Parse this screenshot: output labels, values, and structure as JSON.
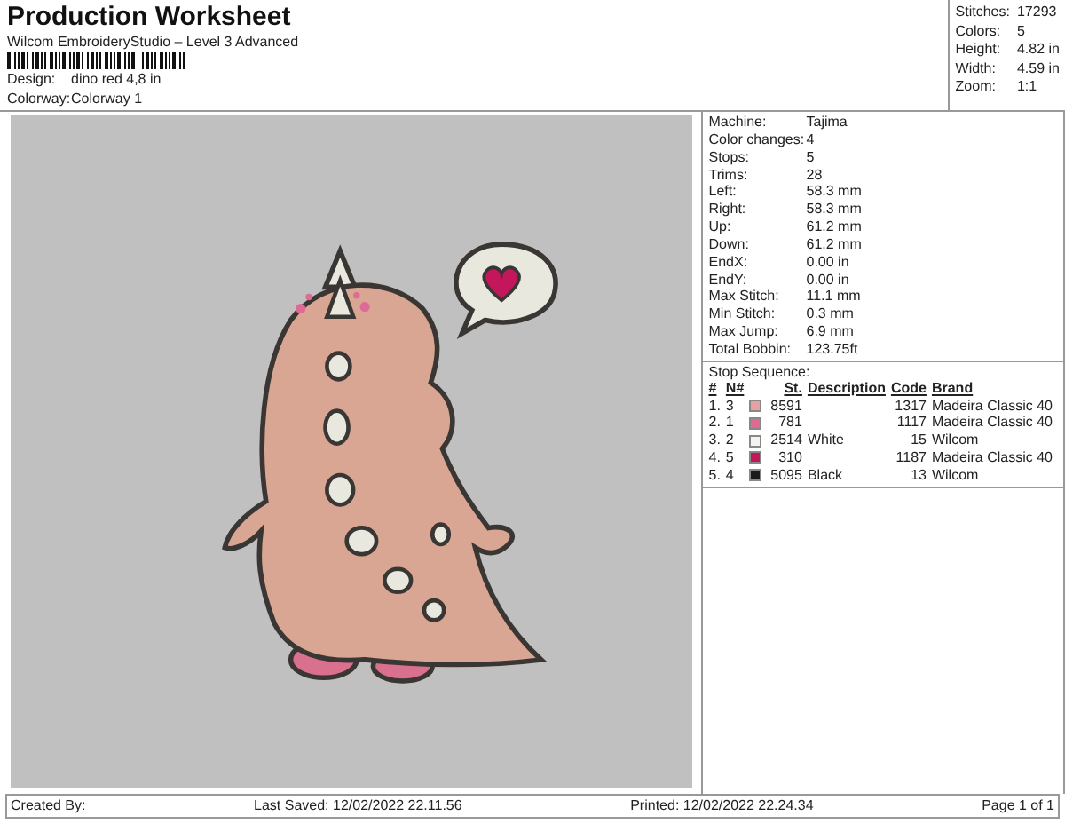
{
  "header": {
    "title": "Production Worksheet",
    "subtitle": "Wilcom EmbroideryStudio – Level 3 Advanced",
    "design": {
      "label": "Design:",
      "value": "dino red 4,8 in"
    },
    "colorway": {
      "label": "Colorway:",
      "value": "Colorway 1"
    }
  },
  "summary": [
    {
      "label": "Stitches:",
      "value": "17293"
    },
    {
      "label": "Colors:",
      "value": "5"
    },
    {
      "label": "Height:",
      "value": "4.82 in"
    },
    {
      "label": "Width:",
      "value": "4.59 in"
    },
    {
      "label": "Zoom:",
      "value": "1:1"
    }
  ],
  "properties": [
    {
      "label": "Machine:",
      "value": "Tajima"
    },
    {
      "label": "Color changes:",
      "value": "4"
    },
    {
      "label": "Stops:",
      "value": "5"
    },
    {
      "label": "Trims:",
      "value": "28"
    },
    {
      "label": "Left:",
      "value": "58.3 mm"
    },
    {
      "label": "Right:",
      "value": "58.3 mm"
    },
    {
      "label": "Up:",
      "value": "61.2 mm"
    },
    {
      "label": "Down:",
      "value": "61.2 mm"
    },
    {
      "label": "EndX:",
      "value": "0.00 in"
    },
    {
      "label": "EndY:",
      "value": "0.00 in"
    },
    {
      "label": "Max Stitch:",
      "value": "11.1 mm"
    },
    {
      "label": "Min Stitch:",
      "value": "0.3 mm"
    },
    {
      "label": "Max Jump:",
      "value": "6.9 mm"
    },
    {
      "label": "Total Bobbin:",
      "value": "123.75ft"
    }
  ],
  "stop_sequence": {
    "title": "Stop Sequence:",
    "columns": [
      "#",
      "N#",
      "St.",
      "Description",
      "Code",
      "Brand"
    ],
    "rows": [
      {
        "index": "1.",
        "needle": "3",
        "color": "#e8a0a0",
        "stitch": "8591",
        "code": "1317",
        "brand": "Madeira Classic 40"
      },
      {
        "index": "2.",
        "needle": "1",
        "color": "#dc6a92",
        "stitch": "781",
        "code": "1117",
        "brand": "Madeira Classic 40"
      },
      {
        "index": "3.",
        "needle": "2",
        "color": "#f4f4f0",
        "stitch": "2514",
        "description": "White",
        "code": "15",
        "brand": "Wilcom"
      },
      {
        "index": "4.",
        "needle": "5",
        "color": "#c4165a",
        "stitch": "310",
        "code": "1187",
        "brand": "Madeira Classic 40"
      },
      {
        "index": "5.",
        "needle": "4",
        "color": "#1a1a1a",
        "stitch": "5095",
        "description": "Black",
        "code": "13",
        "brand": "Wilcom"
      }
    ]
  },
  "footer": {
    "created_by": "Created By:",
    "last_saved": "Last Saved: 12/02/2022 22.11.56",
    "printed": "Printed: 12/02/2022 22.24.34",
    "page": "Page 1 of 1"
  }
}
